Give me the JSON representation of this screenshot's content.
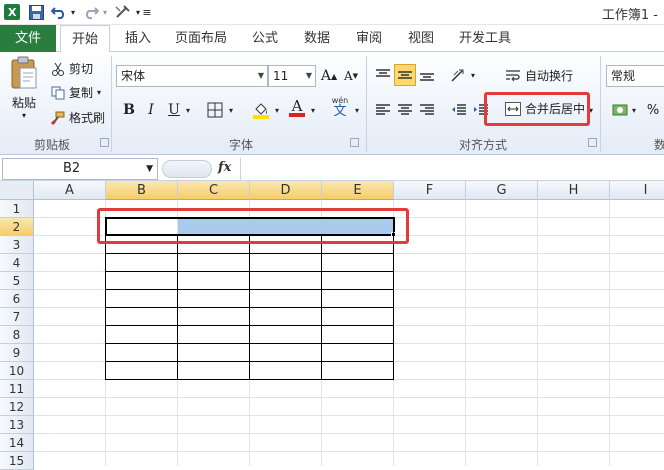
{
  "window": {
    "title": "工作簿1 -"
  },
  "quick_access": {
    "icons": [
      "excel-logo-icon",
      "save-icon",
      "undo-icon",
      "redo-icon",
      "customize-icon"
    ]
  },
  "tabs": [
    "文件",
    "开始",
    "插入",
    "页面布局",
    "公式",
    "数据",
    "审阅",
    "视图",
    "开发工具"
  ],
  "active_tab": "开始",
  "clipboard": {
    "paste": "粘贴",
    "cut": "剪切",
    "copy": "复制",
    "format_painter": "格式刷",
    "group_label": "剪贴板"
  },
  "font": {
    "name": "宋体",
    "size": "11",
    "bold": "B",
    "italic": "I",
    "underline": "U",
    "grow": "A",
    "shrink": "A",
    "font_color_letter": "A",
    "phonetic": "文",
    "phonetic_top": "wén",
    "highlight_color": "#ffe000",
    "font_color": "#e0201f",
    "group_label": "字体"
  },
  "alignment": {
    "wrap_text": "自动换行",
    "merge_center": "合并后居中",
    "group_label": "对齐方式"
  },
  "number": {
    "format": "常规",
    "percent": "%",
    "group_label_partial": "数"
  },
  "formula_bar": {
    "name_box": "B2",
    "fx": "fx",
    "content": ""
  },
  "sheet": {
    "columns": [
      "A",
      "B",
      "C",
      "D",
      "E",
      "F",
      "G",
      "H",
      "I"
    ],
    "selected_columns": [
      "B",
      "C",
      "D",
      "E"
    ],
    "rows": [
      "1",
      "2",
      "3",
      "4",
      "5",
      "6",
      "7",
      "8",
      "9",
      "10",
      "11",
      "12",
      "13",
      "14",
      "15"
    ],
    "selected_row": "2",
    "active_cell": "B2",
    "selection": "B2:E2",
    "table_range": "B2:E10"
  },
  "colors": {
    "file_tab": "#2a7d3e",
    "highlight_box": "#e03c3c",
    "selection_fill": "#a9cbed",
    "header_selected": "#f5cd6b"
  }
}
